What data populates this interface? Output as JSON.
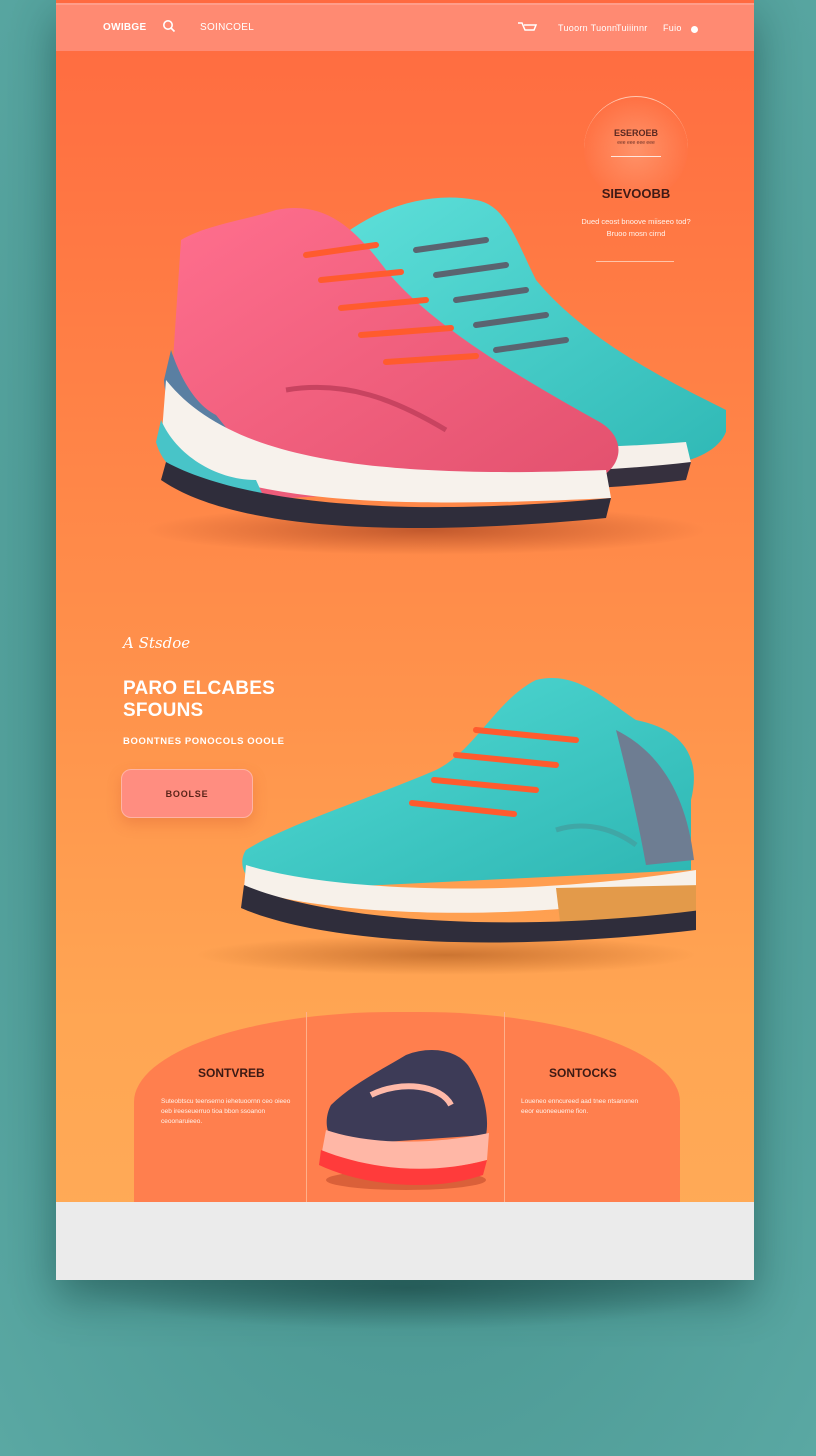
{
  "nav": {
    "brand": "OWIBGE",
    "link_a": "SOINCOEL",
    "link_b": "Tuoorn Tuonn",
    "link_c": "Tuiiinnr",
    "link_d": "Fuio",
    "icons": [
      "search-icon",
      "cart-icon",
      "dot-icon"
    ]
  },
  "hero": {
    "badge_title": "ESEROEB",
    "badge_sub": "eee eee eee eee",
    "heading": "SIEVOOBB",
    "text": "Dued ceost bnoove miiseeo tod? Bruoo mosn cirnd"
  },
  "feature": {
    "script": "A Stsdoe",
    "title_line1": "PARO ELCABES",
    "title_line2": "SFOUNS",
    "subtitle": "BOONTNES PONOCOLS OOOLE",
    "cta": "BOOLSE"
  },
  "cards": [
    {
      "title": "SONTVREB",
      "text": "Suteobtscu teenserno iehetuoornn ceo oieeo oeb ireeseuerruo tioa bbon ssoanon ceoonaruieeo."
    },
    {
      "title": "SONTOCKS",
      "text": "Loueneo enncureed aad tnee ntsanonen eeor euoneeuerne fion."
    }
  ],
  "colors": {
    "page_top": "#ff6a40",
    "page_bottom": "#ffab58",
    "nav": "#ff8a72",
    "teal_backdrop": "#5aa8a2",
    "shoe_pink": "#f0607a",
    "shoe_teal": "#45d6d0"
  }
}
